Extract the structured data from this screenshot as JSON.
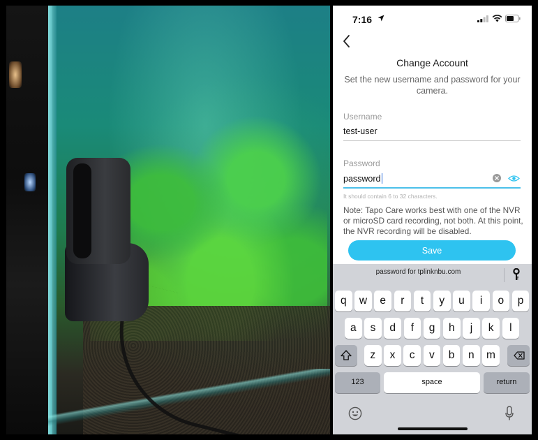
{
  "status_bar": {
    "time": "7:16",
    "location_icon": "location-arrow-icon",
    "signal_icon": "cellular-signal-icon",
    "wifi_icon": "wifi-icon",
    "battery_icon": "battery-icon"
  },
  "nav": {
    "back_icon": "chevron-left-icon"
  },
  "page": {
    "title": "Change Account",
    "subtitle": "Set the new username and password for your camera."
  },
  "form": {
    "username_label": "Username",
    "username_value": "test-user",
    "password_label": "Password",
    "password_value": "password",
    "password_hint": "It should contain 6 to 32 characters.",
    "clear_icon": "clear-circle-icon",
    "visibility_icon": "eye-icon",
    "note": "Note: Tapo Care works best with one of the NVR or microSD card recording, not both. At this point, the NVR recording will be disabled.",
    "save_label": "Save"
  },
  "keyboard": {
    "suggestion": "password for tplinknbu.com",
    "suggestion_icon": "key-icon",
    "row1": [
      "q",
      "w",
      "e",
      "r",
      "t",
      "y",
      "u",
      "i",
      "o",
      "p"
    ],
    "row2": [
      "a",
      "s",
      "d",
      "f",
      "g",
      "h",
      "j",
      "k",
      "l"
    ],
    "row3": [
      "z",
      "x",
      "c",
      "v",
      "b",
      "n",
      "m"
    ],
    "numbers_label": "123",
    "space_label": "space",
    "return_label": "return",
    "shift_icon": "shift-icon",
    "backspace_icon": "backspace-icon",
    "emoji_icon": "emoji-icon",
    "mic_icon": "microphone-icon"
  },
  "colors": {
    "accent": "#2ec3f0",
    "keyboard_bg": "#d1d3d8"
  }
}
